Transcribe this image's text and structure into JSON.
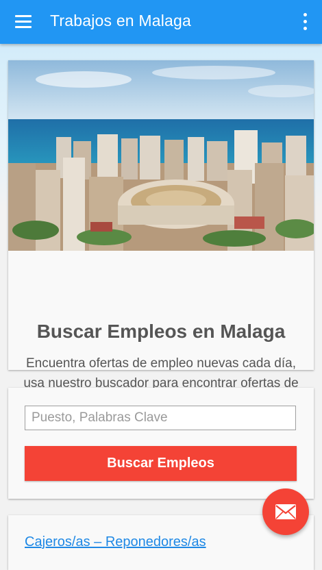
{
  "app": {
    "title": "Trabajos en Malaga",
    "accent": "#2196f3",
    "action": "#f44336"
  },
  "appbar": {
    "menu_icon": "hamburger-menu-icon",
    "more_icon": "more-vert-icon"
  },
  "hero": {
    "image": "malaga-city-bullring-photo",
    "title": "Buscar Empleos en Malaga",
    "description": "Encuentra ofertas de empleo nuevas cada día, usa nuestro buscador para encontrar ofertas de trabajo locales."
  },
  "search": {
    "placeholder": "Puesto, Palabras Clave",
    "value": "",
    "button_label": "Buscar Empleos"
  },
  "jobs": {
    "items": [
      "Cajeros/as – Reponedores/as"
    ]
  },
  "fab": {
    "icon": "mail-icon"
  }
}
